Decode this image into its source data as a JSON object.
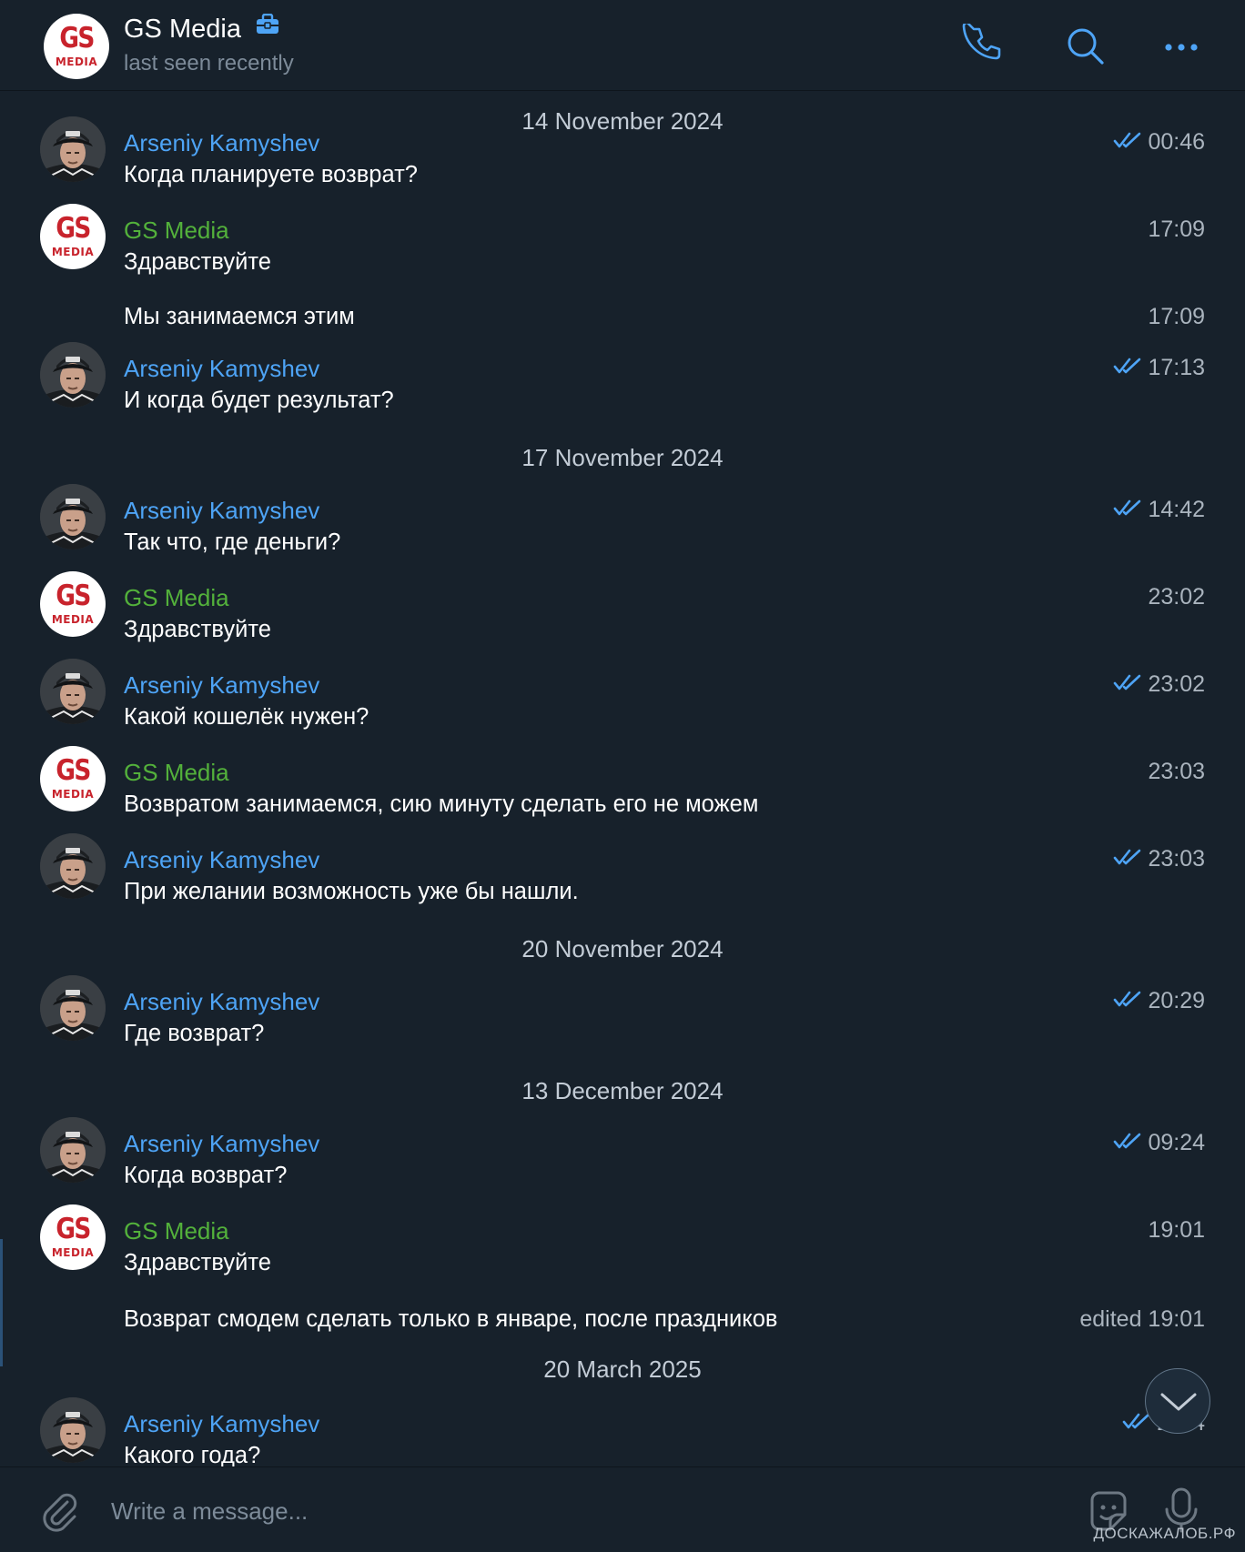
{
  "header": {
    "title": "GS Media",
    "status": "last seen recently",
    "badge_icon": "briefcase-icon",
    "actions": [
      "phone-icon",
      "search-icon",
      "more-icon"
    ]
  },
  "avatars": {
    "gs_logo_top": "GS",
    "gs_logo_bottom": "MEDIA"
  },
  "dates": {
    "d1": "14 November 2024",
    "d2": "17 November 2024",
    "d3": "20 November 2024",
    "d4": "13 December 2024",
    "d5": "20 March 2025"
  },
  "messages": [
    {
      "sender": "Arseniy Kamyshev",
      "text": "Когда планируете возврат?",
      "time": "00:46",
      "read": true
    },
    {
      "sender": "GS Media",
      "text": "Здравствуйте",
      "time": "17:09"
    },
    {
      "text": "Мы занимаемся этим",
      "time": "17:09"
    },
    {
      "sender": "Arseniy Kamyshev",
      "text": "И когда будет результат?",
      "time": "17:13",
      "read": true
    },
    {
      "sender": "Arseniy Kamyshev",
      "text": "Так что, где деньги?",
      "time": "14:42",
      "read": true
    },
    {
      "sender": "GS Media",
      "text": "Здравствуйте",
      "time": "23:02"
    },
    {
      "sender": "Arseniy Kamyshev",
      "text": "Какой кошелёк нужен?",
      "time": "23:02",
      "read": true
    },
    {
      "sender": "GS Media",
      "text": "Возвратом занимаемся, сию минуту сделать его не можем",
      "time": "23:03"
    },
    {
      "sender": "Arseniy Kamyshev",
      "text": "При желании возможность уже бы нашли.",
      "time": "23:03",
      "read": true
    },
    {
      "sender": "Arseniy Kamyshev",
      "text": "Где возврат?",
      "time": "20:29",
      "read": true
    },
    {
      "sender": "Arseniy Kamyshev",
      "text": "Когда возврат?",
      "time": "09:24",
      "read": true
    },
    {
      "sender": "GS Media",
      "text": "Здравствуйте",
      "time": "19:01"
    },
    {
      "text": "Возврат смодем сделать только в январе, после праздников",
      "time": "edited 19:01"
    },
    {
      "sender": "Arseniy Kamyshev",
      "text": "Какого года?",
      "time": "2…4",
      "read": true
    }
  ],
  "composer": {
    "placeholder": "Write a message...",
    "icons": [
      "paperclip-icon",
      "sticker-icon",
      "microphone-icon"
    ]
  },
  "scroll_button_icon": "chevron-down-icon",
  "watermark": "ДОСКАЖАЛОБ.РФ",
  "colors": {
    "background": "#17212b",
    "accent": "#4ea4f6",
    "sender_own": "#4ea4f6",
    "sender_other": "#53b13b",
    "meta": "#aab4be",
    "logo_red": "#c8232c"
  }
}
